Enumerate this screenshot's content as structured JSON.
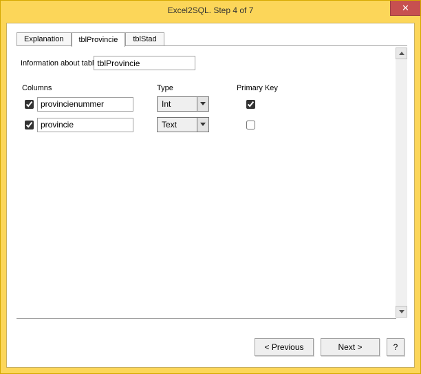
{
  "window": {
    "title": "Excel2SQL. Step 4 of 7",
    "close_glyph": "✕"
  },
  "tabs": {
    "explanation": "Explanation",
    "tblProvincie": "tblProvincie",
    "tblStad": "tblStad"
  },
  "panel": {
    "info_label": "Information about tabl",
    "table_name": "tblProvincie",
    "headers": {
      "columns": "Columns",
      "type": "Type",
      "pk": "Primary Key"
    },
    "rows": [
      {
        "enabled": true,
        "name": "provincienummer",
        "type": "Int",
        "pk": true
      },
      {
        "enabled": true,
        "name": "provincie",
        "type": "Text",
        "pk": false
      }
    ]
  },
  "footer": {
    "previous": "< Previous",
    "next": "Next >",
    "help": "?"
  }
}
